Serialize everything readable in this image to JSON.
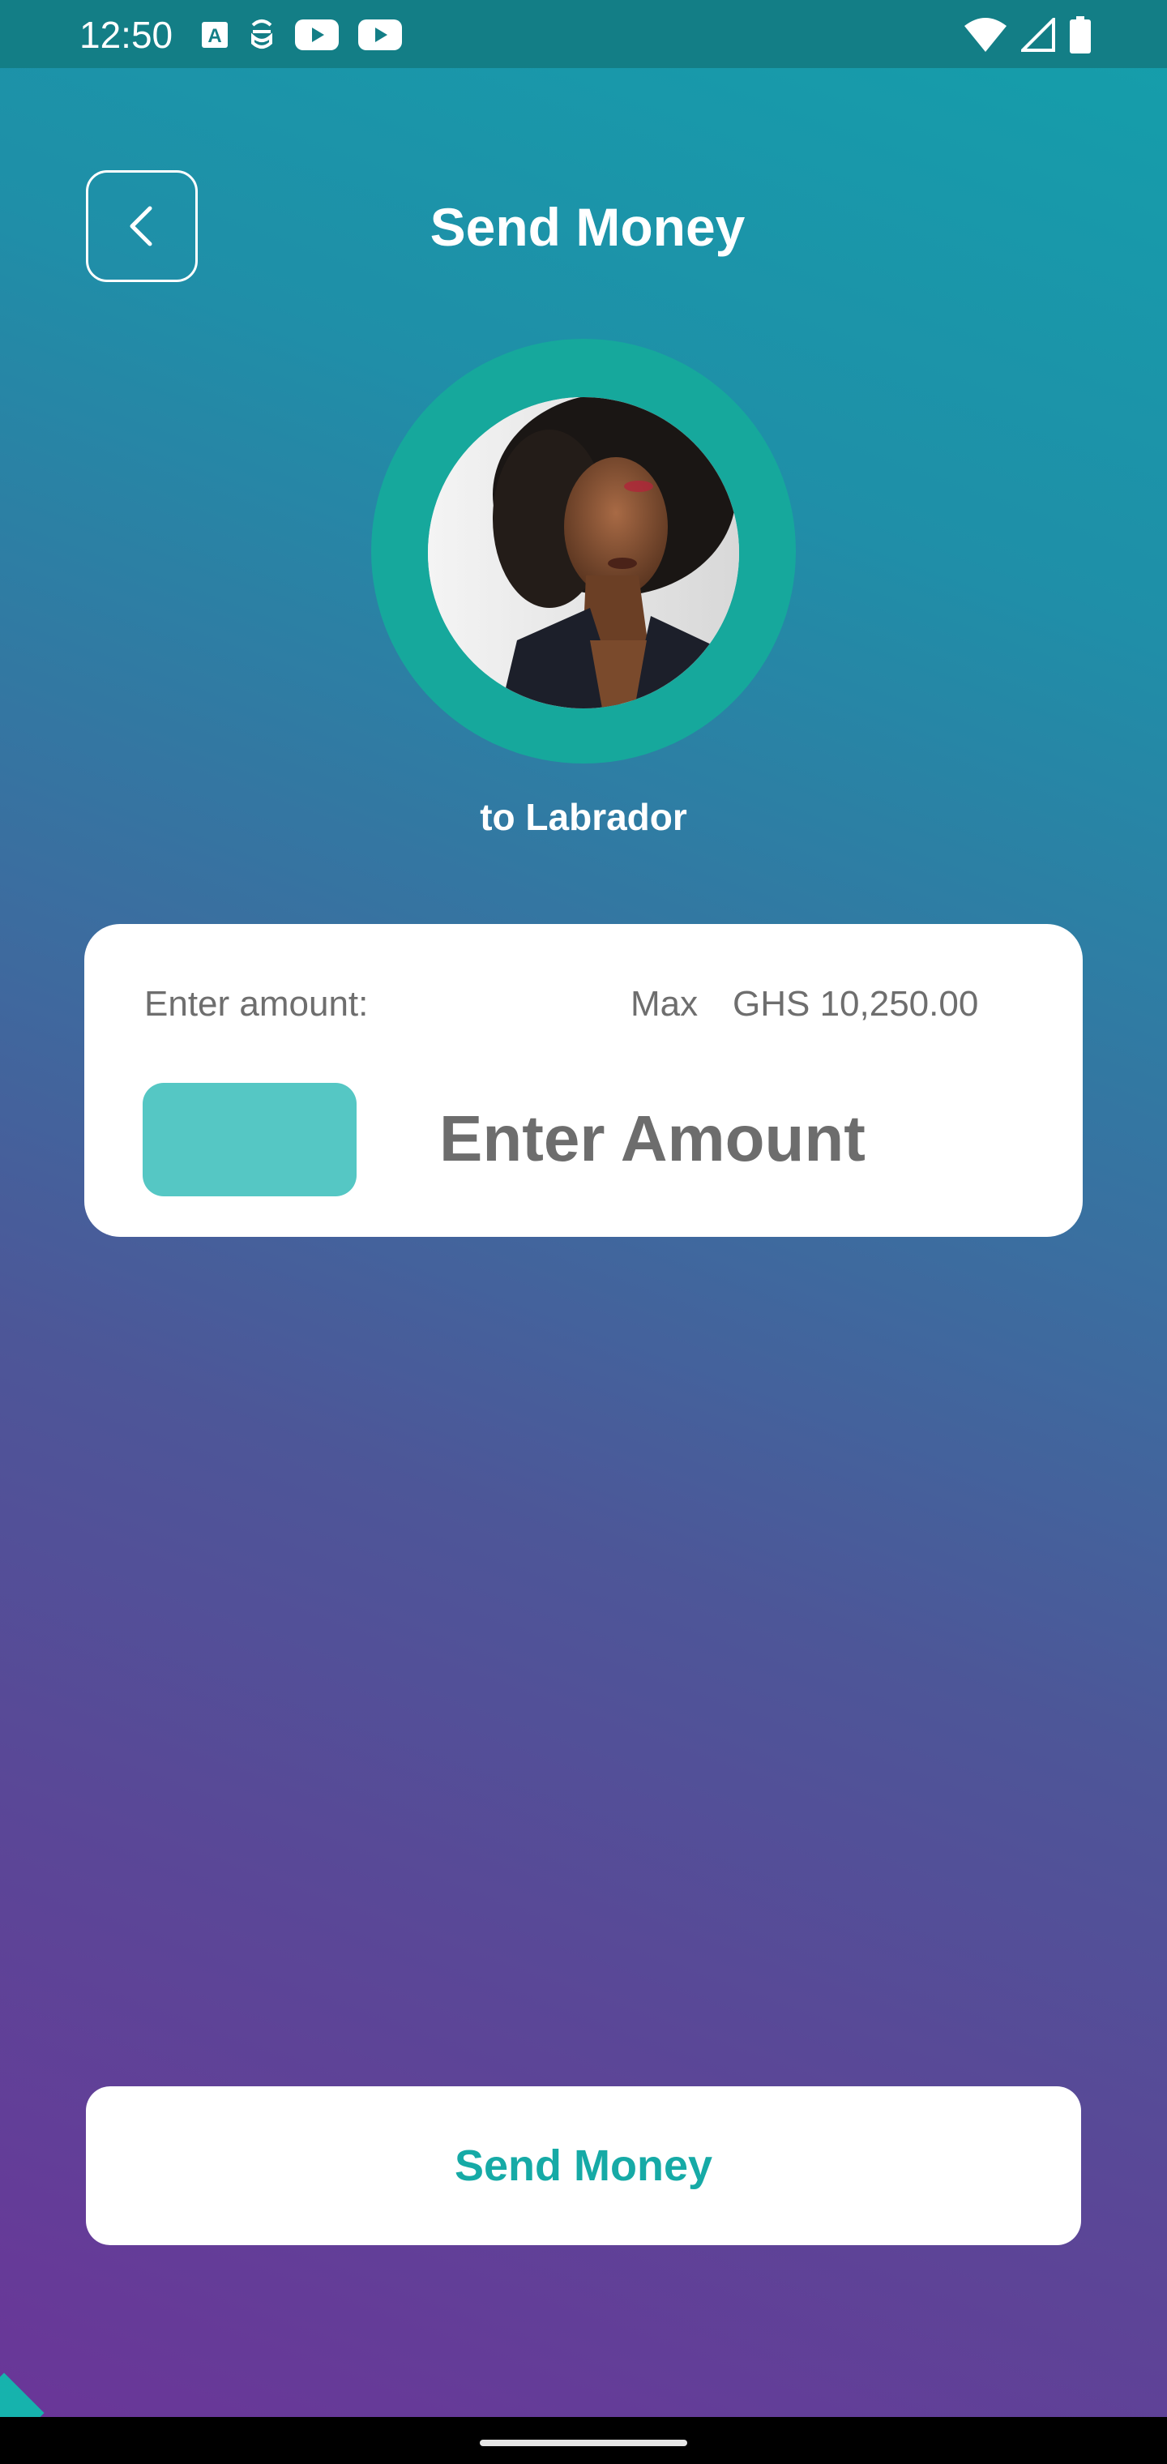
{
  "status_bar": {
    "time": "12:50",
    "left_icons": [
      "font-a-icon",
      "robot-icon",
      "youtube-icon",
      "youtube-icon"
    ],
    "right_icons": [
      "wifi-icon",
      "signal-icon",
      "battery-icon"
    ]
  },
  "header": {
    "title": "Send Money",
    "back_icon": "chevron-left-icon"
  },
  "recipient": {
    "label": "to Labrador",
    "avatar": "profile-photo"
  },
  "amount_card": {
    "amount_label": "Enter amount:",
    "max_label": "Max",
    "max_value": "GHS 10,250.00",
    "input_placeholder": "Enter Amount"
  },
  "actions": {
    "send_label": "Send Money"
  },
  "colors": {
    "accent": "#16aaa6",
    "chip": "#55c7c4",
    "ring": "#16a89c",
    "gradient_top": "#149fab",
    "gradient_bottom": "#6a3698"
  }
}
